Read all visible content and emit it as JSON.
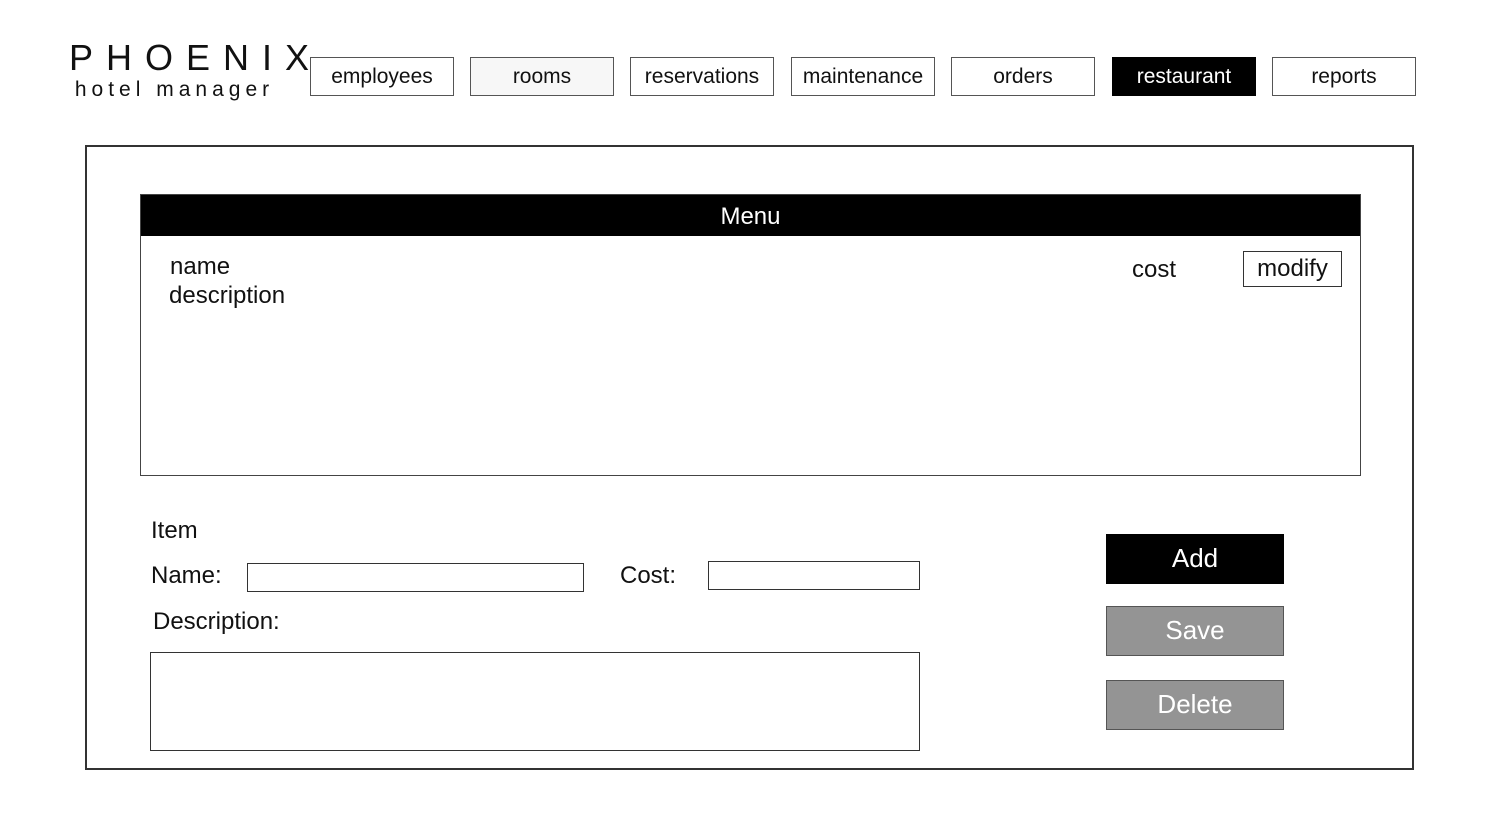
{
  "app": {
    "logo_title": "PHOENIX",
    "logo_subtitle": "hotel manager"
  },
  "nav": {
    "items": [
      {
        "label": "employees"
      },
      {
        "label": "rooms"
      },
      {
        "label": "reservations"
      },
      {
        "label": "maintenance"
      },
      {
        "label": "orders"
      },
      {
        "label": "restaurant"
      },
      {
        "label": "reports"
      }
    ],
    "active": "restaurant"
  },
  "menu": {
    "title": "Menu",
    "columns": {
      "name": "name",
      "description": "description",
      "cost": "cost"
    },
    "modify_label": "modify"
  },
  "form": {
    "section_label": "Item",
    "name_label": "Name:",
    "name_value": "",
    "cost_label": "Cost:",
    "cost_value": "",
    "description_label": "Description:",
    "description_value": ""
  },
  "actions": {
    "add_label": "Add",
    "save_label": "Save",
    "delete_label": "Delete"
  },
  "colors": {
    "active_nav_bg": "#000000",
    "primary_button": "#000000",
    "disabled_button": "#949494"
  }
}
